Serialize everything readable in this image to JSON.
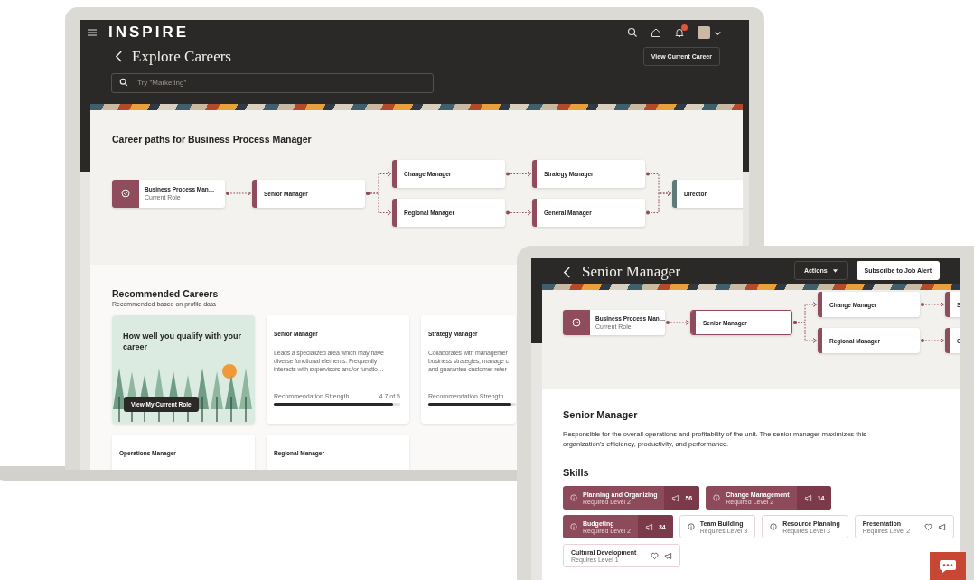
{
  "laptop": {
    "header": {
      "logo": "INSPIRE",
      "page_title": "Explore Careers",
      "action_button": "View Current Career",
      "search": {
        "placeholder": "Try \"Marketing\""
      }
    },
    "career_paths": {
      "title": "Career paths for Business Process Manager",
      "columns": [
        [
          {
            "kind": "current",
            "name": "Business Process Man…",
            "subtitle": "Current Role",
            "selected": false,
            "color": "#8f4c5c"
          }
        ],
        [
          {
            "kind": "role",
            "name": "Senior Manager",
            "selected": false,
            "color": "#8f4c5c"
          }
        ],
        [
          {
            "kind": "role",
            "name": "Change Manager",
            "selected": false,
            "color": "#8f4c5c"
          },
          {
            "kind": "role",
            "name": "Regional Manager",
            "selected": false,
            "color": "#8f4c5c"
          }
        ],
        [
          {
            "kind": "role",
            "name": "Strategy Manager",
            "selected": false,
            "color": "#8f4c5c"
          },
          {
            "kind": "role",
            "name": "General Manager",
            "selected": false,
            "color": "#8f4c5c"
          }
        ],
        [
          {
            "kind": "role",
            "name": "Director",
            "selected": false,
            "color": "#5f7b79"
          }
        ]
      ]
    },
    "recommended": {
      "title": "Recommended Careers",
      "subtitle": "Recommended based on profile data",
      "cards": [
        {
          "kind": "promo",
          "title": "How well you qualify with your career",
          "button": "View My Current Role"
        },
        {
          "kind": "career",
          "title": "Senior Manager",
          "description": "Leads a specialized area which may have diverse functional elements. Frequently interacts with supervisors and/or functio…",
          "strength_label": "Recommendation Strength",
          "strength_value": "4.7 of 5",
          "level": 0.94
        },
        {
          "kind": "career",
          "title": "Strategy Manager",
          "description": "Collaborates with managemer\nbusiness strategies, manage c\nand guarantee customer reter",
          "strength_label": "Recommendation Strength",
          "level": 0.95
        },
        {
          "kind": "career",
          "title": "Operations Manager"
        },
        {
          "kind": "career",
          "title": "Regional Manager"
        }
      ]
    }
  },
  "tablet": {
    "header": {
      "page_title": "Senior Manager",
      "actions_button": "Actions",
      "subscribe_button": "Subscribe to Job Alert"
    },
    "career_paths": {
      "columns": [
        [
          {
            "kind": "current",
            "name": "Business Process Man…",
            "subtitle": "Current Role",
            "selected": false,
            "color": "#8f4c5c"
          }
        ],
        [
          {
            "kind": "role",
            "name": "Senior Manager",
            "selected": true,
            "color": "#8f4c5c"
          }
        ],
        [
          {
            "kind": "role",
            "name": "Change Manager",
            "selected": false,
            "color": "#8f4c5c"
          },
          {
            "kind": "role",
            "name": "Regional Manager",
            "selected": false,
            "color": "#8f4c5c"
          }
        ],
        [
          {
            "kind": "role",
            "name": "S",
            "selected": false,
            "color": "#8f4c5c"
          },
          {
            "kind": "role",
            "name": "G",
            "selected": false,
            "color": "#8f4c5c"
          }
        ]
      ]
    },
    "role": {
      "title": "Senior Manager",
      "description": "Responsible for the overall operations and profitability of the unit. The senior manager maximizes this organization's efficiency, productivity, and performance."
    },
    "skills": {
      "title": "Skills",
      "rows": [
        [
          {
            "kind": "required",
            "name": "Planning and Organizing",
            "level_text": "Required Level 2",
            "count": "56"
          },
          {
            "kind": "required",
            "name": "Change Management",
            "level_text": "Required Level 2",
            "count": "14"
          }
        ],
        [
          {
            "kind": "required",
            "name": "Budgeting",
            "level_text": "Required Level 2",
            "count": "34"
          },
          {
            "kind": "suggested",
            "name": "Team Building",
            "level_text": "Requires Level 3"
          },
          {
            "kind": "suggested",
            "name": "Resource Planning",
            "level_text": "Requires Level 3"
          },
          {
            "kind": "favorite",
            "name": "Presentation",
            "level_text": "Requires Level 2"
          }
        ],
        [
          {
            "kind": "favorite",
            "name": "Cultural Development",
            "level_text": "Requires Level 1"
          }
        ]
      ]
    }
  }
}
